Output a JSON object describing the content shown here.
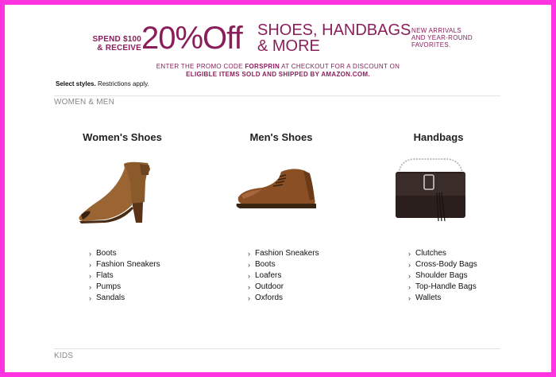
{
  "banner": {
    "spend_line1": "SPEND $100",
    "spend_line2": "& RECEIVE",
    "discount": "20%Off",
    "categories_line1": "SHOES, HANDBAGS",
    "categories_line2": "& MORE",
    "arrivals_line1": "NEW ARRIVALS",
    "arrivals_line2": "AND YEAR-ROUND",
    "arrivals_line3": "FAVORITES.",
    "promo_prefix": "ENTER THE PROMO CODE",
    "promo_code": "FORSPRIN",
    "promo_suffix": "AT CHECKOUT FOR A DISCOUNT ON",
    "promo_line2": "ELIGIBLE ITEMS SOLD AND SHIPPED BY AMAZON.COM.",
    "select_bold": "Select styles.",
    "select_rest": "Restrictions apply.",
    "color": "#8a1e5b"
  },
  "sections": {
    "women_men": "WOMEN & MEN",
    "kids": "KIDS"
  },
  "columns": [
    {
      "title": "Women's Shoes",
      "image_icon": "brown-peep-toe-bootie",
      "links": [
        "Boots",
        "Fashion Sneakers",
        "Flats",
        "Pumps",
        "Sandals"
      ]
    },
    {
      "title": "Men's Shoes",
      "image_icon": "brown-lace-up-chukka",
      "links": [
        "Fashion Sneakers",
        "Boots",
        "Loafers",
        "Outdoor",
        "Oxfords"
      ]
    },
    {
      "title": "Handbags",
      "image_icon": "black-chain-crossbody-bag",
      "links": [
        "Clutches",
        "Cross-Body Bags",
        "Shoulder Bags",
        "Top-Handle Bags",
        "Wallets"
      ]
    }
  ],
  "chevron": "›",
  "frame_color": "#ff33e0"
}
